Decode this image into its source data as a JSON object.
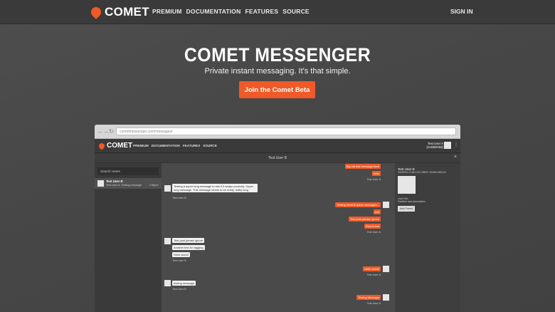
{
  "nav": {
    "brand": "COMET",
    "links": [
      "PREMIUM",
      "DOCUMENTATION",
      "FEATURES",
      "SOURCE"
    ],
    "signin": "SIGN IN"
  },
  "hero": {
    "title": "COMET MESSENGER",
    "subtitle": "Private instant messaging. It's that simple.",
    "cta": "Join the Comet Beta"
  },
  "browser": {
    "url": "cometmessenger.com/messages/"
  },
  "app": {
    "brand": "COMET",
    "links": [
      "PREMIUM",
      "DOCUMENTATION",
      "FEATURES",
      "SOURCE"
    ],
    "user_name": "Test User A",
    "user_handle": "(GoldWHit3)",
    "conversation_title": "Test User B",
    "search_placeholder": "Search Users",
    "conversation": {
      "name": "Test User B",
      "last": "Test User A: Testing message",
      "time": "2:56pm"
    },
    "messages": {
      "m1": "Big old test message here",
      "m2": "hello",
      "a1": "Test User A",
      "m3": "Testing a super long message to see if it wraps correctly. Super long message. This message needs to be really, really long.",
      "b1": "Test User B",
      "m4": "Testing several quick messages...",
      "m5": "test",
      "m6": "Test post please ignore",
      "m7": "Round two",
      "a2": "Test User A",
      "m8": "Test post please ignore",
      "m9": "Another test for tagging",
      "m10": "Hello world!",
      "b2": "Test User B",
      "m11": "Hello world!",
      "a3": "Test User A",
      "m12": "testing message",
      "b3": "Test User B",
      "m13": "Testing Message",
      "a4": "Test User A"
    },
    "profile": {
      "name": "Test User B",
      "id": "342f6925-C138-47AC-9BEE-75246C4DE310",
      "bio_label": "User Bio",
      "bio": "Darklink aws description",
      "add_friend": "Add Friend"
    }
  }
}
